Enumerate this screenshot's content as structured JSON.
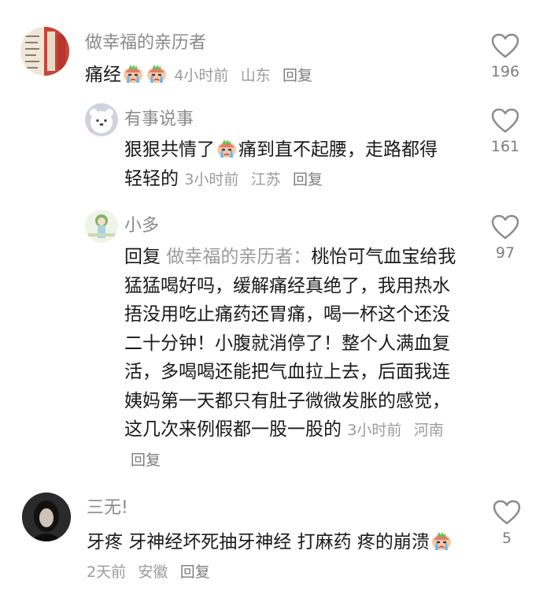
{
  "comments": [
    {
      "author": "做幸福的亲历者",
      "text_a": "痛经",
      "text_b": "",
      "time": "4小时前",
      "location": "山东",
      "reply_label": "回复",
      "likes": "196",
      "emoji_count": 2
    },
    {
      "author": "有事说事",
      "text_a": "狠狠共情了",
      "text_b": "痛到直不起腰，走路都得轻轻的",
      "time": "3小时前",
      "location": "江苏",
      "reply_label": "回复",
      "likes": "161"
    },
    {
      "author": "小多",
      "reply_prefix": "回复",
      "reply_to": "做幸福的亲历者：",
      "text": "桃怡可气血宝给我猛猛喝好吗，缓解痛经真绝了，我用热水捂没用吃止痛药还胃痛，喝一杯这个还没二十分钟！小腹就消停了！整个人满血复活，多喝喝还能把气血拉上去，后面我连姨妈第一天都只有肚子微微发胀的感觉，这几次来例假都一股一股的",
      "time": "3小时前",
      "location": "河南",
      "reply_label": "回复",
      "likes": "97"
    },
    {
      "author": "三无!",
      "text": "牙疼 牙神经坏死抽牙神经 打麻药 疼的崩溃",
      "time": "2天前",
      "location": "安徽",
      "reply_label": "回复",
      "likes": "5"
    }
  ],
  "colors": {
    "meta": "#9b9b9b",
    "text": "#1a1a1a",
    "name": "#8a8a8a"
  },
  "icons": [
    "heart-outline-icon",
    "crying-emoji-icon"
  ]
}
